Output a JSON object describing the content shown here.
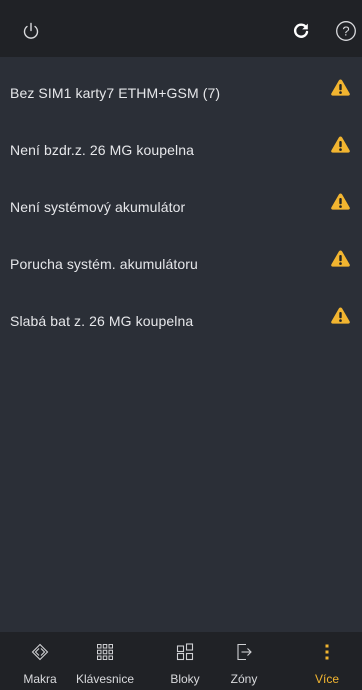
{
  "header": {
    "power_icon": "power-icon",
    "refresh_icon": "refresh-icon",
    "help_icon": "help-icon"
  },
  "faults": [
    {
      "text": "Bez SIM1 karty7 ETHM+GSM   (7)",
      "icon": "warning-icon"
    },
    {
      "text": "Není bzdr.z. 26 MG koupelna",
      "icon": "warning-icon"
    },
    {
      "text": "Není systémový akumulátor",
      "icon": "warning-icon"
    },
    {
      "text": "Porucha systém. akumulátoru",
      "icon": "warning-icon"
    },
    {
      "text": "Slabá bat z. 26 MG koupelna",
      "icon": "warning-icon"
    }
  ],
  "nav": {
    "tabs": [
      {
        "label": "Makra",
        "icon": "macro-icon"
      },
      {
        "label": "Klávesnice",
        "icon": "keypad-icon"
      },
      {
        "label": "Bloky",
        "icon": "blocks-icon"
      },
      {
        "label": "Zóny",
        "icon": "zones-icon"
      },
      {
        "label": "Více",
        "icon": "more-icon"
      }
    ],
    "active": "Více"
  },
  "colors": {
    "background": "#2b2f37",
    "bar": "#202226",
    "accent": "#f2b530",
    "text": "#e6e7ea"
  }
}
